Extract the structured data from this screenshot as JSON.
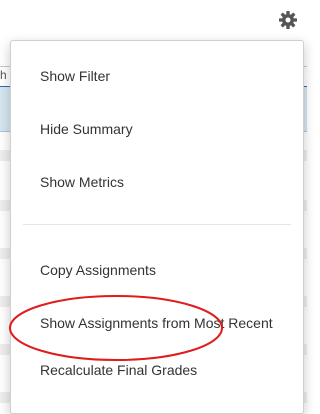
{
  "menu": {
    "items": [
      {
        "label": "Show Filter"
      },
      {
        "label": "Hide Summary"
      },
      {
        "label": "Show Metrics"
      },
      {
        "label": "Copy Assignments"
      },
      {
        "label": "Show Assignments from Most Recent"
      },
      {
        "label": "Recalculate Final Grades"
      }
    ]
  },
  "background": {
    "edge_text": "h"
  },
  "colors": {
    "gear_icon": "#555555",
    "annotation_ellipse": "#e01b1b",
    "header_bar": "#d7e6f1",
    "menu_text": "#333333"
  },
  "icons": {
    "settings": "gear-icon"
  }
}
